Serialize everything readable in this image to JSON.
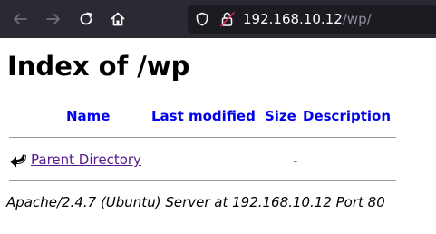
{
  "browser": {
    "url_host": "192.168.10.12",
    "url_path": "/wp/",
    "icons": [
      "back-arrow-icon",
      "forward-arrow-icon",
      "reload-icon",
      "home-icon",
      "shield-icon",
      "insecure-lock-icon"
    ],
    "toolbar_color": "#2b2a33"
  },
  "page": {
    "title": "Index of /wp",
    "columns": {
      "name": "Name",
      "last_modified": "Last modified",
      "size": "Size",
      "description": "Description"
    },
    "rows": [
      {
        "name": "Parent Directory",
        "last_modified": "",
        "size": "-",
        "description": "",
        "icon": "back-icon"
      }
    ],
    "footer": "Apache/2.4.7 (Ubuntu) Server at 192.168.10.12 Port 80",
    "link_color": "#0000ee",
    "visited_link_color": "#551a8b"
  }
}
